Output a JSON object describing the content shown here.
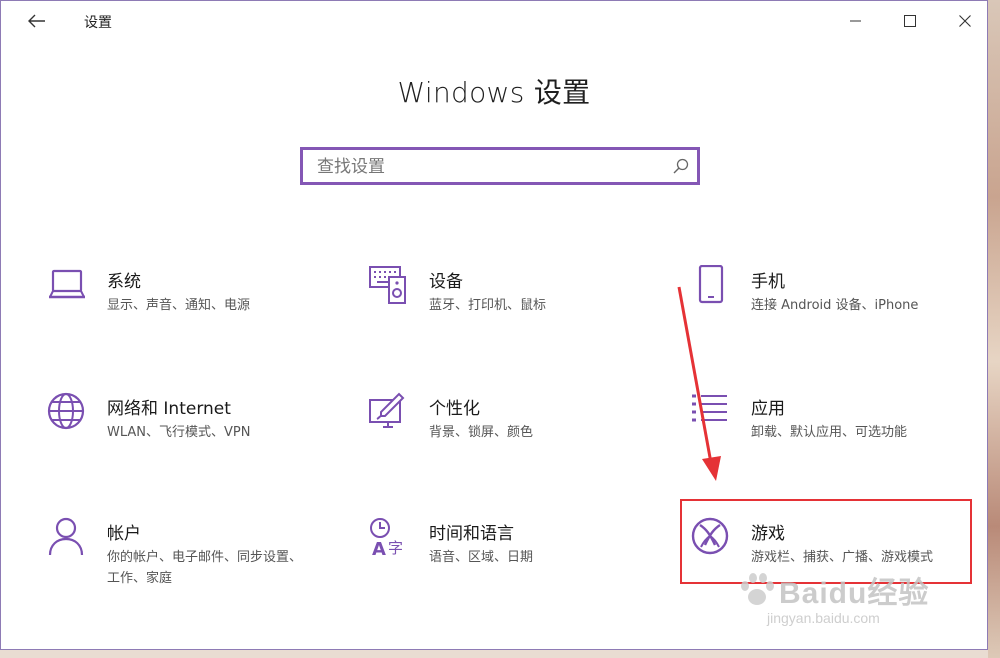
{
  "window": {
    "title": "设置",
    "heading": "Windows 设置",
    "accent_color": "#7a4fb1",
    "highlight_color": "#e53236"
  },
  "search": {
    "placeholder": "查找设置",
    "value": ""
  },
  "titlebar_icons": [
    "back-arrow-icon",
    "minimize-icon",
    "maximize-icon",
    "close-icon"
  ],
  "tiles": [
    {
      "name": "系统",
      "desc": "显示、声音、通知、电源",
      "icon": "laptop-icon"
    },
    {
      "name": "设备",
      "desc": "蓝牙、打印机、鼠标",
      "icon": "keyboard-speaker-icon"
    },
    {
      "name": "手机",
      "desc": "连接 Android 设备、iPhone",
      "icon": "phone-icon"
    },
    {
      "name": "网络和 Internet",
      "desc": "WLAN、飞行模式、VPN",
      "icon": "globe-icon"
    },
    {
      "name": "个性化",
      "desc": "背景、锁屏、颜色",
      "icon": "paintbrush-icon"
    },
    {
      "name": "应用",
      "desc": "卸载、默认应用、可选功能",
      "icon": "apps-list-icon"
    },
    {
      "name": "帐户",
      "desc": "你的帐户、电子邮件、同步设置、工作、家庭",
      "icon": "person-icon"
    },
    {
      "name": "时间和语言",
      "desc": "语音、区域、日期",
      "icon": "time-language-icon"
    },
    {
      "name": "游戏",
      "desc": "游戏栏、捕获、广播、游戏模式",
      "icon": "xbox-icon"
    }
  ],
  "watermark": {
    "brand": "Baidu经验",
    "url": "jingyan.baidu.com"
  }
}
